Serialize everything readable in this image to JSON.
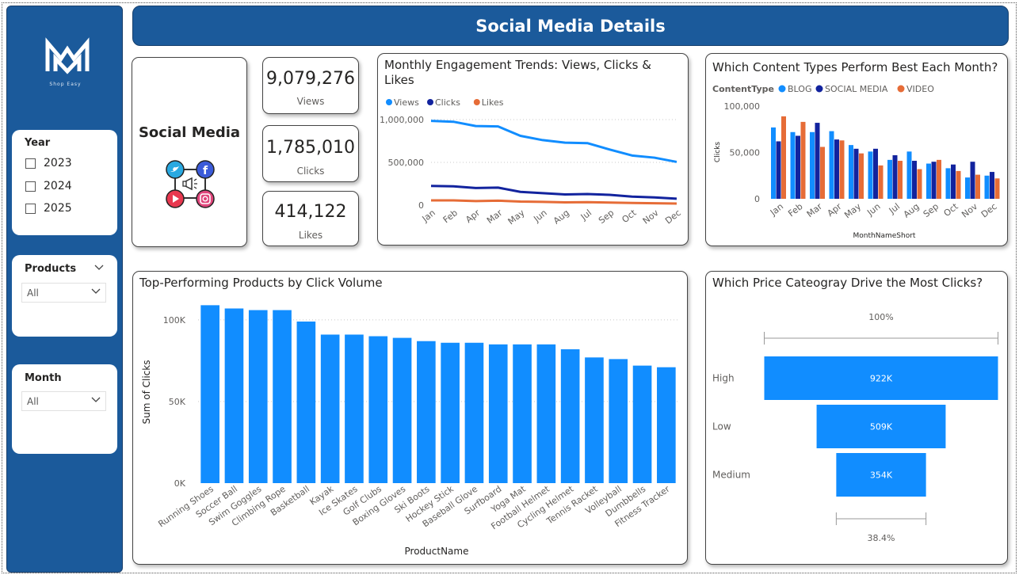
{
  "header": {
    "title": "Social Media Details"
  },
  "logo": {
    "subtitle": "Shop Easy"
  },
  "slicers": {
    "year": {
      "title": "Year",
      "options": [
        "2023",
        "2024",
        "2025"
      ]
    },
    "products": {
      "title": "Products",
      "value": "All"
    },
    "month": {
      "title": "Month",
      "value": "All"
    }
  },
  "social_card": {
    "title": "Social Media"
  },
  "kpis": [
    {
      "value": "9,079,276",
      "label": "Views"
    },
    {
      "value": "1,785,010",
      "label": "Clicks"
    },
    {
      "value": "414,122",
      "label": "Likes"
    }
  ],
  "colors": {
    "brand": "#1B5A9B",
    "views": "#118DFF",
    "clicks": "#12239E",
    "likes": "#E66C37"
  },
  "charts": {
    "trend": {
      "title": "Monthly Engagement Trends: Views, Clicks & Likes",
      "title_line1": "Monthly Engagement Trends: Views, Clicks &",
      "title_line2": "Likes"
    },
    "content": {
      "title": "Which Content Types Perform Best Each Month?",
      "legend_title": "ContentType"
    },
    "products": {
      "title": "Top-Performing Products by Click Volume"
    },
    "price": {
      "title": "Which Price Cateogray Drive the Most Clicks?"
    }
  },
  "chart_data": [
    {
      "id": "trend",
      "type": "line",
      "title": "Monthly Engagement Trends: Views, Clicks & Likes",
      "categories": [
        "Jan",
        "Feb",
        "Apr",
        "Mar",
        "May",
        "Jun",
        "Aug",
        "Jul",
        "Sep",
        "Oct",
        "Nov",
        "Dec"
      ],
      "series": [
        {
          "name": "Views",
          "values": [
            985000,
            975000,
            925000,
            920000,
            810000,
            760000,
            730000,
            725000,
            650000,
            580000,
            555000,
            505000
          ]
        },
        {
          "name": "Clicks",
          "values": [
            225000,
            220000,
            200000,
            205000,
            155000,
            140000,
            125000,
            130000,
            120000,
            100000,
            90000,
            75000
          ]
        },
        {
          "name": "Likes",
          "values": [
            55000,
            56000,
            48000,
            52000,
            42000,
            38000,
            32000,
            35000,
            30000,
            25000,
            22000,
            18000
          ]
        }
      ],
      "y_ticks": [
        "0",
        "500,000",
        "1,000,000"
      ],
      "ylim": [
        0,
        1000000
      ],
      "grid": true,
      "legend": "top-left"
    },
    {
      "id": "content",
      "type": "bar",
      "title": "Which Content Types Perform Best Each Month?",
      "xlabel": "MonthNameShort",
      "ylabel": "Clicks",
      "categories": [
        "Jan",
        "Feb",
        "Mar",
        "Apr",
        "May",
        "Jun",
        "Jul",
        "Aug",
        "Sep",
        "Oct",
        "Nov",
        "Dec"
      ],
      "series": [
        {
          "name": "BLOG",
          "values": [
            77000,
            72000,
            72000,
            73000,
            58000,
            51000,
            42000,
            51000,
            38000,
            33000,
            23000,
            25000
          ]
        },
        {
          "name": "SOCIAL MEDIA",
          "values": [
            62000,
            68000,
            82000,
            64000,
            54000,
            54000,
            47000,
            41000,
            40000,
            37000,
            40000,
            29000
          ]
        },
        {
          "name": "VIDEO",
          "values": [
            89000,
            83000,
            56000,
            63000,
            49000,
            36000,
            41000,
            32000,
            42000,
            30000,
            26000,
            22000
          ]
        }
      ],
      "y_ticks": [
        "0",
        "50,000",
        "100,000"
      ],
      "ylim": [
        0,
        100000
      ],
      "legend": "top-left"
    },
    {
      "id": "products",
      "type": "bar",
      "title": "Top-Performing Products by Click Volume",
      "xlabel": "ProductName",
      "ylabel": "Sum of Clicks",
      "categories": [
        "Running Shoes",
        "Soccer Ball",
        "Swim Goggles",
        "Climbing Rope",
        "Basketball",
        "Kayak",
        "Ice Skates",
        "Golf Clubs",
        "Boxing Gloves",
        "Ski Boots",
        "Hockey Stick",
        "Baseball Glove",
        "Surfboard",
        "Yoga Mat",
        "Football Helmet",
        "Cycling Helmet",
        "Tennis Racket",
        "Volleyball",
        "Dumbbells",
        "Fitness Tracker"
      ],
      "values": [
        109000,
        107000,
        106000,
        106000,
        99000,
        91000,
        91000,
        90000,
        89000,
        87000,
        86000,
        86000,
        85000,
        85000,
        85000,
        82000,
        77000,
        76000,
        72000,
        71000
      ],
      "y_ticks": [
        "0K",
        "50K",
        "100K"
      ],
      "ylim": [
        0,
        115000
      ],
      "grid": true
    },
    {
      "id": "price",
      "type": "bar",
      "subtype": "funnel",
      "title": "Which Price Cateogray Drive the Most Clicks?",
      "categories": [
        "High",
        "Low",
        "Medium"
      ],
      "values": [
        922000,
        509000,
        354000
      ],
      "value_labels": [
        "922K",
        "509K",
        "354K"
      ],
      "top_label": "100%",
      "bottom_label": "38.4%"
    }
  ]
}
